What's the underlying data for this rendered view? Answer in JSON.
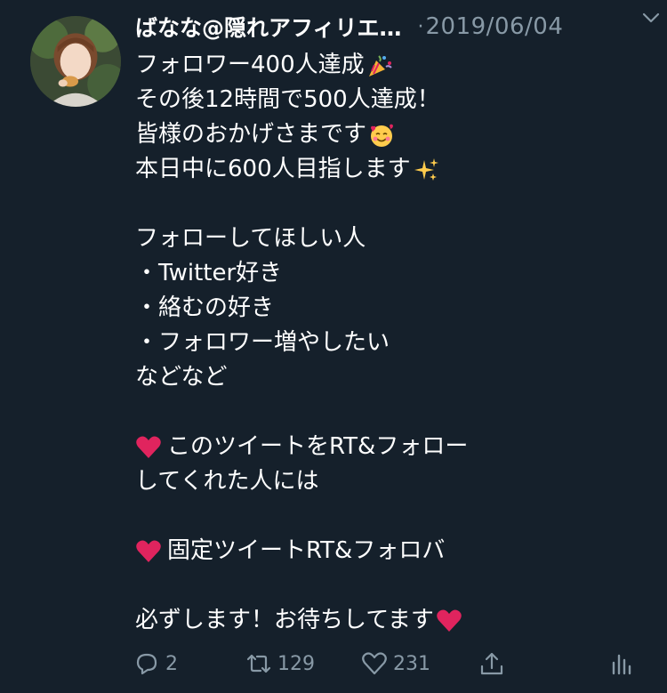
{
  "user": {
    "display_name": "ばなな@隠れアフィリエ…",
    "separator": "·",
    "timestamp": "2019/06/04"
  },
  "tweet": {
    "l1": "フォロワー400人達成",
    "l2": "その後12時間で500人達成！",
    "l3": "皆様のおかげさまです",
    "l4": "本日中に600人目指します",
    "l5": "フォローしてほしい人",
    "l6": "・Twitter好き",
    "l7": "・絡むの好き",
    "l8": "・フォロワー増やしたい",
    "l9": "などなど",
    "l10": "このツイートをRT&フォロー",
    "l11": "してくれた人には",
    "l12": "固定ツイートRT&フォロバ",
    "l13": "必ずします！お待ちしてます"
  },
  "actions": {
    "reply_count": "2",
    "retweet_count": "129",
    "like_count": "231"
  },
  "icons": {
    "reply": "reply-icon",
    "retweet": "retweet-icon",
    "like": "heart-icon",
    "share": "share-icon",
    "analytics": "analytics-icon",
    "menu": "chevron-down-icon"
  },
  "colors": {
    "background": "#15202b",
    "muted": "#8899a6",
    "text": "#ffffff",
    "heart": "#e0245e"
  }
}
